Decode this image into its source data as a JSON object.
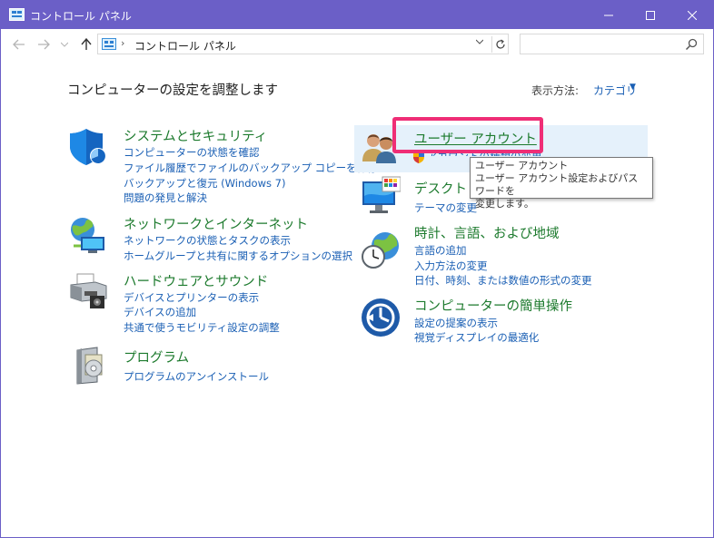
{
  "window": {
    "title": "コントロール パネル"
  },
  "nav": {
    "back_icon": "back-arrow-icon",
    "forward_icon": "forward-arrow-icon",
    "recent_icon": "chevron-down-icon",
    "up_icon": "up-arrow-icon"
  },
  "address": {
    "separator": "›",
    "crumb": "コントロール パネル"
  },
  "search": {
    "value": "",
    "placeholder": ""
  },
  "header": {
    "heading": "コンピューターの設定を調整します",
    "view_by_label": "表示方法:",
    "view_by_value": "カテゴリ"
  },
  "categories_left": [
    {
      "title": "システムとセキュリティ",
      "icon": "shield-icon",
      "links": [
        "コンピューターの状態を確認",
        "ファイル履歴でファイルのバックアップ コピーを保存",
        "バックアップと復元 (Windows 7)",
        "問題の発見と解決"
      ]
    },
    {
      "title": "ネットワークとインターネット",
      "icon": "network-globe-icon",
      "links": [
        "ネットワークの状態とタスクの表示",
        "ホームグループと共有に関するオプションの選択"
      ]
    },
    {
      "title": "ハードウェアとサウンド",
      "icon": "printer-icon",
      "links": [
        "デバイスとプリンターの表示",
        "デバイスの追加",
        "共通で使うモビリティ設定の調整"
      ]
    },
    {
      "title": "プログラム",
      "icon": "programs-icon",
      "links": [
        "プログラムのアンインストール"
      ]
    }
  ],
  "categories_right": [
    {
      "title": "ユーザー アカウント",
      "icon": "users-icon",
      "links": [
        "アカウントの種類の変更"
      ]
    },
    {
      "title": "デスクトップのカスタマイズ",
      "icon": "desktop-icon",
      "links": [
        "テーマの変更"
      ]
    },
    {
      "title": "時計、言語、および地域",
      "icon": "clock-globe-icon",
      "links": [
        "言語の追加",
        "入力方法の変更",
        "日付、時刻、または数値の形式の変更"
      ]
    },
    {
      "title": "コンピューターの簡単操作",
      "icon": "ease-of-access-icon",
      "links": [
        "設定の提案の表示",
        "視覚ディスプレイの最適化"
      ]
    }
  ],
  "tooltip": {
    "line1": "ユーザー アカウント",
    "line2": "ユーザー アカウント設定およびパスワードを",
    "line3": "変更します。"
  },
  "colors": {
    "titlebar": "#6b5fc7",
    "category_title": "#1c7a2d",
    "link": "#1a5fb4",
    "highlight_box": "#ef2e76",
    "hover_bg": "#e5f1fb"
  }
}
